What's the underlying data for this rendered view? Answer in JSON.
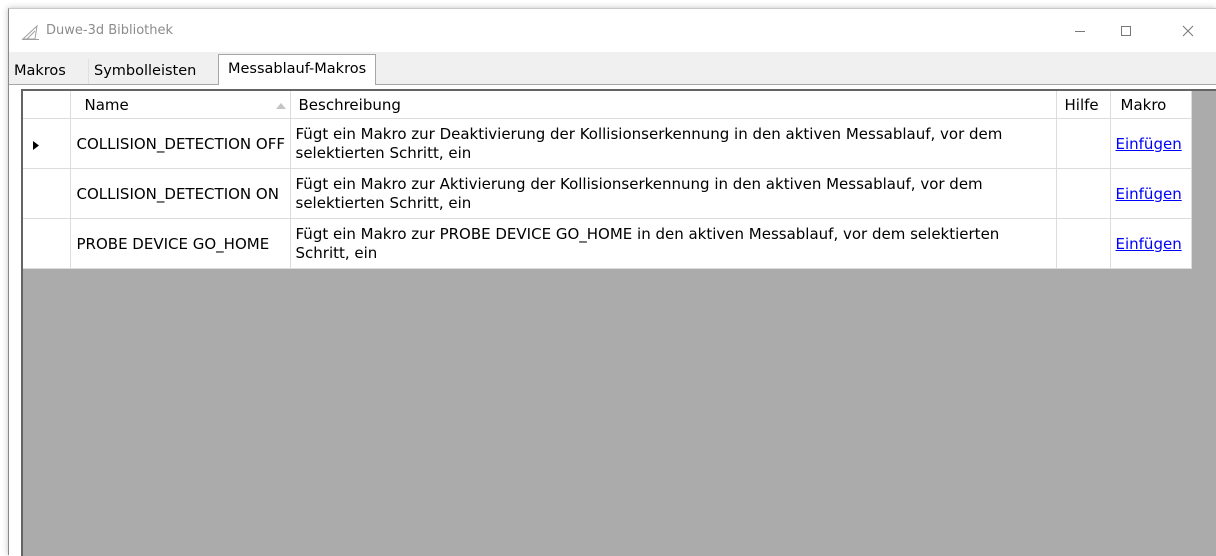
{
  "window": {
    "title": "Duwe-3d Bibliothek"
  },
  "tabs": [
    {
      "label": "Makros",
      "active": false
    },
    {
      "label": "Symbolleisten",
      "active": false
    },
    {
      "label": "Messablauf-Makros",
      "active": true
    }
  ],
  "grid": {
    "columns": {
      "name": "Name",
      "description": "Beschreibung",
      "help": "Hilfe",
      "macro": "Makro"
    },
    "sort": {
      "column": "Name",
      "direction": "ascending"
    },
    "rows": [
      {
        "name": "COLLISION_DETECTION OFF",
        "description": "Fügt ein Makro zur Deaktivierung der Kollisionserkennung in den aktiven Messablauf, vor dem selektierten Schritt, ein",
        "help": "",
        "action": "Einfügen",
        "current": true
      },
      {
        "name": "COLLISION_DETECTION ON",
        "description": "Fügt ein Makro zur Aktivierung der Kollisionserkennung in den aktiven Messablauf, vor dem selektierten Schritt, ein",
        "help": "",
        "action": "Einfügen",
        "current": false
      },
      {
        "name": "PROBE DEVICE GO_HOME",
        "description": "Fügt ein Makro zur PROBE DEVICE GO_HOME in den aktiven Messablauf, vor dem selektierten Schritt, ein",
        "help": "",
        "action": "Einfügen",
        "current": false
      }
    ]
  },
  "colors": {
    "link": "#0000ff",
    "grid_background": "#ababab",
    "title_text": "#8c8c8c"
  }
}
